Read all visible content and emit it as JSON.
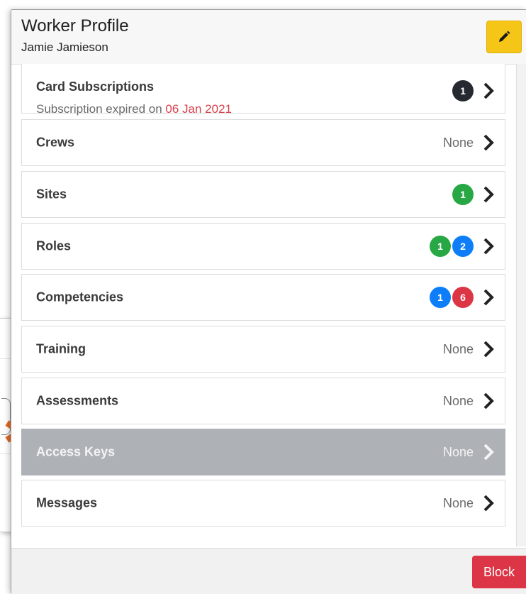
{
  "header": {
    "title": "Worker Profile",
    "subtitle": "Jamie Jamieson",
    "edit_icon": "pencil-icon",
    "edit_color": "#f5c518"
  },
  "items": [
    {
      "label": "Card Subscriptions",
      "sub_prefix": "Subscription expired on ",
      "sub_date": "06 Jan 2021",
      "badges": [
        {
          "value": "1",
          "color": "#262a30"
        }
      ]
    },
    {
      "label": "Crews",
      "status": "None"
    },
    {
      "label": "Sites",
      "badges": [
        {
          "value": "1",
          "color": "#28a745"
        }
      ]
    },
    {
      "label": "Roles",
      "badges": [
        {
          "value": "1",
          "color": "#28a745"
        },
        {
          "value": "2",
          "color": "#0d7ef8"
        }
      ]
    },
    {
      "label": "Competencies",
      "badges": [
        {
          "value": "1",
          "color": "#0d7ef8"
        },
        {
          "value": "6",
          "color": "#dc3545"
        }
      ]
    },
    {
      "label": "Training",
      "status": "None"
    },
    {
      "label": "Assessments",
      "status": "None"
    },
    {
      "label": "Access Keys",
      "status": "None",
      "active": true
    },
    {
      "label": "Messages",
      "status": "None"
    }
  ],
  "footer": {
    "block_label": "Block",
    "block_color": "#dc3545"
  },
  "annotation": {
    "arrow_color": "#e06a26"
  }
}
